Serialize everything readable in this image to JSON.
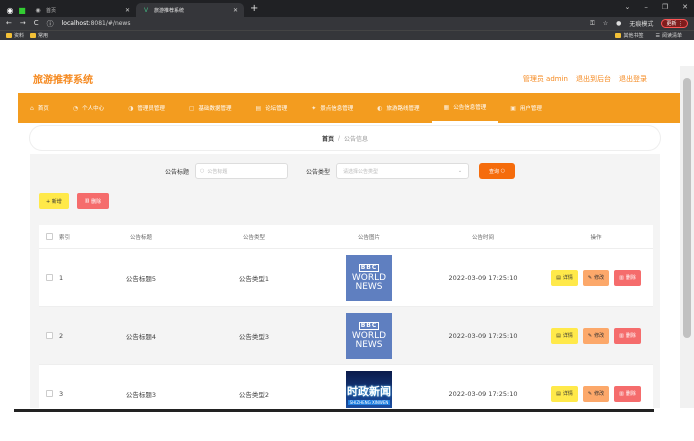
{
  "browser": {
    "tabs": [
      {
        "label": "首页",
        "active": false
      },
      {
        "label": "旅游推荐系统",
        "active": true
      }
    ],
    "url_host": "localhost",
    "url_rest": ":8081/#/news",
    "incognito_label": "无痕模式",
    "update_label": "更新",
    "bookmarks": [
      "资料",
      "常用"
    ],
    "bookmarks_right": [
      "其他书签",
      "阅读清单"
    ]
  },
  "header": {
    "logo": "旅游推荐系统",
    "admin": "管理员 admin",
    "backend": "退出到后台",
    "logout": "退出登录"
  },
  "nav": {
    "items": [
      {
        "label": "首页",
        "icon": "home-icon"
      },
      {
        "label": "个人中心",
        "icon": "user-icon"
      },
      {
        "label": "管理员管理",
        "icon": "admin-icon"
      },
      {
        "label": "基础数据管理",
        "icon": "data-icon"
      },
      {
        "label": "论坛管理",
        "icon": "forum-icon"
      },
      {
        "label": "景点信息管理",
        "icon": "spot-icon"
      },
      {
        "label": "旅游路线管理",
        "icon": "route-icon"
      },
      {
        "label": "公告信息管理",
        "icon": "notice-icon"
      },
      {
        "label": "用户管理",
        "icon": "users-icon"
      }
    ],
    "active_index": 7
  },
  "breadcrumb": {
    "home": "首页",
    "separator": "/",
    "current": "公告信息"
  },
  "search": {
    "title_label": "公告标题",
    "title_placeholder": "公告标题",
    "type_label": "公告类型",
    "type_placeholder": "请选择公告类型",
    "query_button": "查询"
  },
  "actions": {
    "add": "+ 新增",
    "delete": "删除"
  },
  "table": {
    "headers": {
      "index": "索引",
      "title": "公告标题",
      "type": "公告类型",
      "image": "公告图片",
      "time": "公告时间",
      "ops": "操作"
    },
    "rows": [
      {
        "index": "1",
        "title": "公告标题5",
        "type": "公告类型1",
        "image": "bbc",
        "time": "2022-03-09 17:25:10"
      },
      {
        "index": "2",
        "title": "公告标题4",
        "type": "公告类型3",
        "image": "bbc",
        "time": "2022-03-09 17:25:10"
      },
      {
        "index": "3",
        "title": "公告标题3",
        "type": "公告类型2",
        "image": "cn",
        "time": "2022-03-09 17:25:10"
      }
    ],
    "op_labels": {
      "detail": "详情",
      "edit": "修改",
      "delete": "删除"
    },
    "bbc_text": {
      "logo": "BBC",
      "line1": "WORLD",
      "line2": "NEWS"
    },
    "cn_text": {
      "title": "时政新闻",
      "sub": "SHIZHENG XINWEN"
    }
  },
  "colors": {
    "accent": "#f39c1f",
    "brand": "#f5891f",
    "danger": "#f56c6c",
    "warning": "#ffe94a"
  }
}
